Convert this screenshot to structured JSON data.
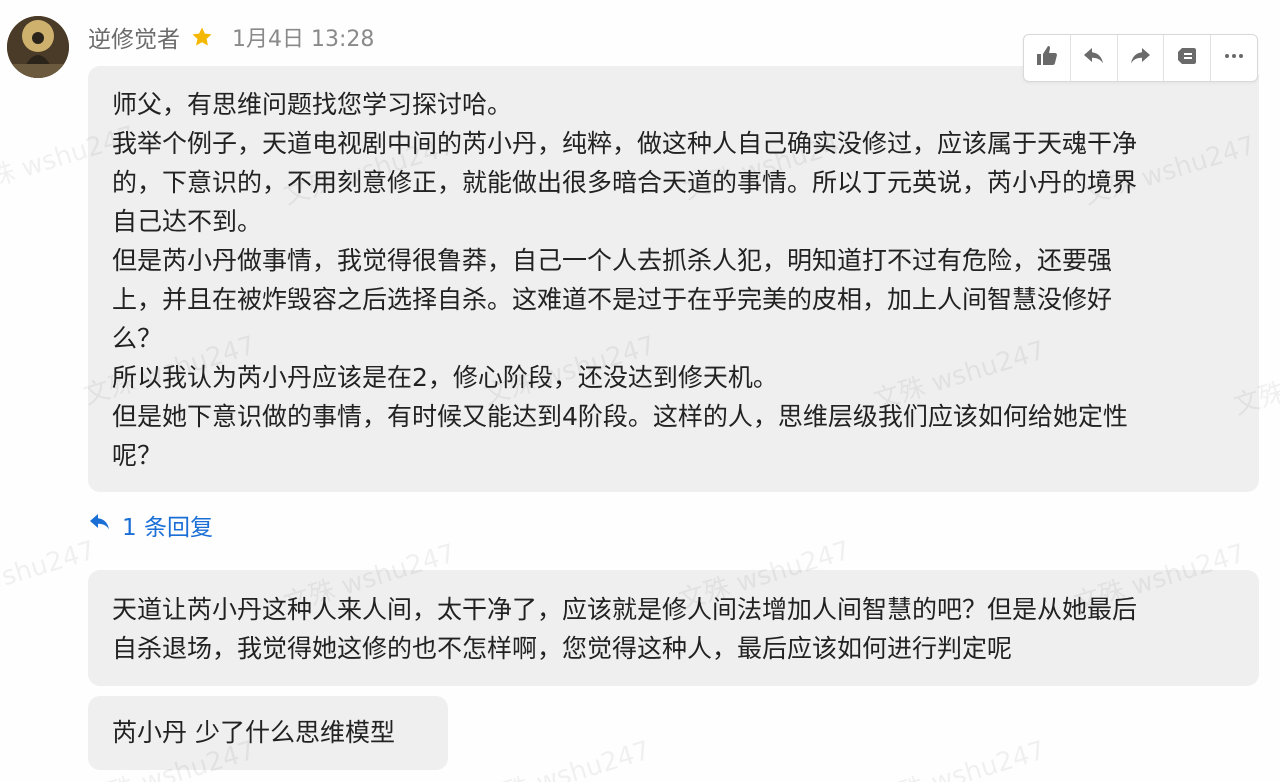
{
  "post": {
    "author": "逆修觉者",
    "timestamp": "1月4日 13:28",
    "lines": [
      "师父，有思维问题找您学习探讨哈。",
      "我举个例子，天道电视剧中间的芮小丹，纯粹，做这种人自己确实没修过，应该属于天魂干净",
      "的，下意识的，不用刻意修正，就能做出很多暗合天道的事情。所以丁元英说，芮小丹的境界",
      "自己达不到。",
      "但是芮小丹做事情，我觉得很鲁莽，自己一个人去抓杀人犯，明知道打不过有危险，还要强",
      "上，并且在被炸毁容之后选择自杀。这难道不是过于在乎完美的皮相，加上人间智慧没修好",
      "么？",
      "所以我认为芮小丹应该是在2，修心阶段，还没达到修天机。",
      "但是她下意识做的事情，有时候又能达到4阶段。这样的人，思维层级我们应该如何给她定性",
      "呢？"
    ]
  },
  "toolbar": {
    "icons": [
      "thumbs-up-icon",
      "reply-icon",
      "forward-icon",
      "archive-icon",
      "more-icon"
    ]
  },
  "replies_link": {
    "label": "1 条回复",
    "color": "#1a6fd6"
  },
  "replies": [
    {
      "lines": [
        "天道让芮小丹这种人来人间，太干净了，应该就是修人间法增加人间智慧的吧？但是从她最后",
        "自杀退场，我觉得她这修的也不怎样啊，您觉得这种人，最后应该如何进行判定呢"
      ]
    },
    {
      "lines": [
        "芮小丹 少了什么思维模型"
      ]
    }
  ],
  "watermark": "文殊 wshu247",
  "colors": {
    "bubble": "#efefef",
    "accent": "#1a6fd6",
    "star": "#f5b800"
  }
}
